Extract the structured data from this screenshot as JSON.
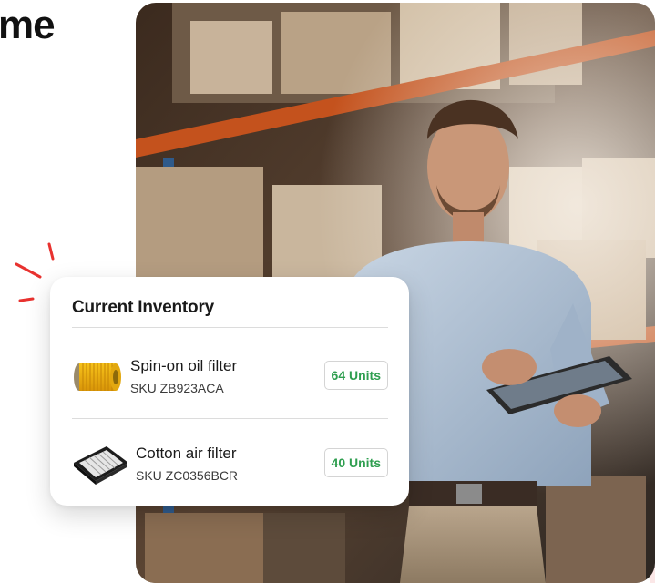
{
  "headline": {
    "fragment": "me"
  },
  "inventory_card": {
    "title": "Current Inventory",
    "items": [
      {
        "name": "Spin-on oil filter",
        "sku_prefix": "SKU",
        "sku": "ZB923ACA",
        "sku_text": "SKU ZB923ACA",
        "units": "64 Units",
        "icon": "oil-filter-icon"
      },
      {
        "name": "Cotton air filter",
        "sku_prefix": "SKU",
        "sku": "ZC0356BCR",
        "sku_text": "SKU ZC0356BCR",
        "units": "40 Units",
        "icon": "air-filter-icon"
      }
    ]
  },
  "colors": {
    "units_green": "#2e9e4f",
    "sparkle_red": "#e8322f",
    "text_dark": "#1a1a1a"
  }
}
